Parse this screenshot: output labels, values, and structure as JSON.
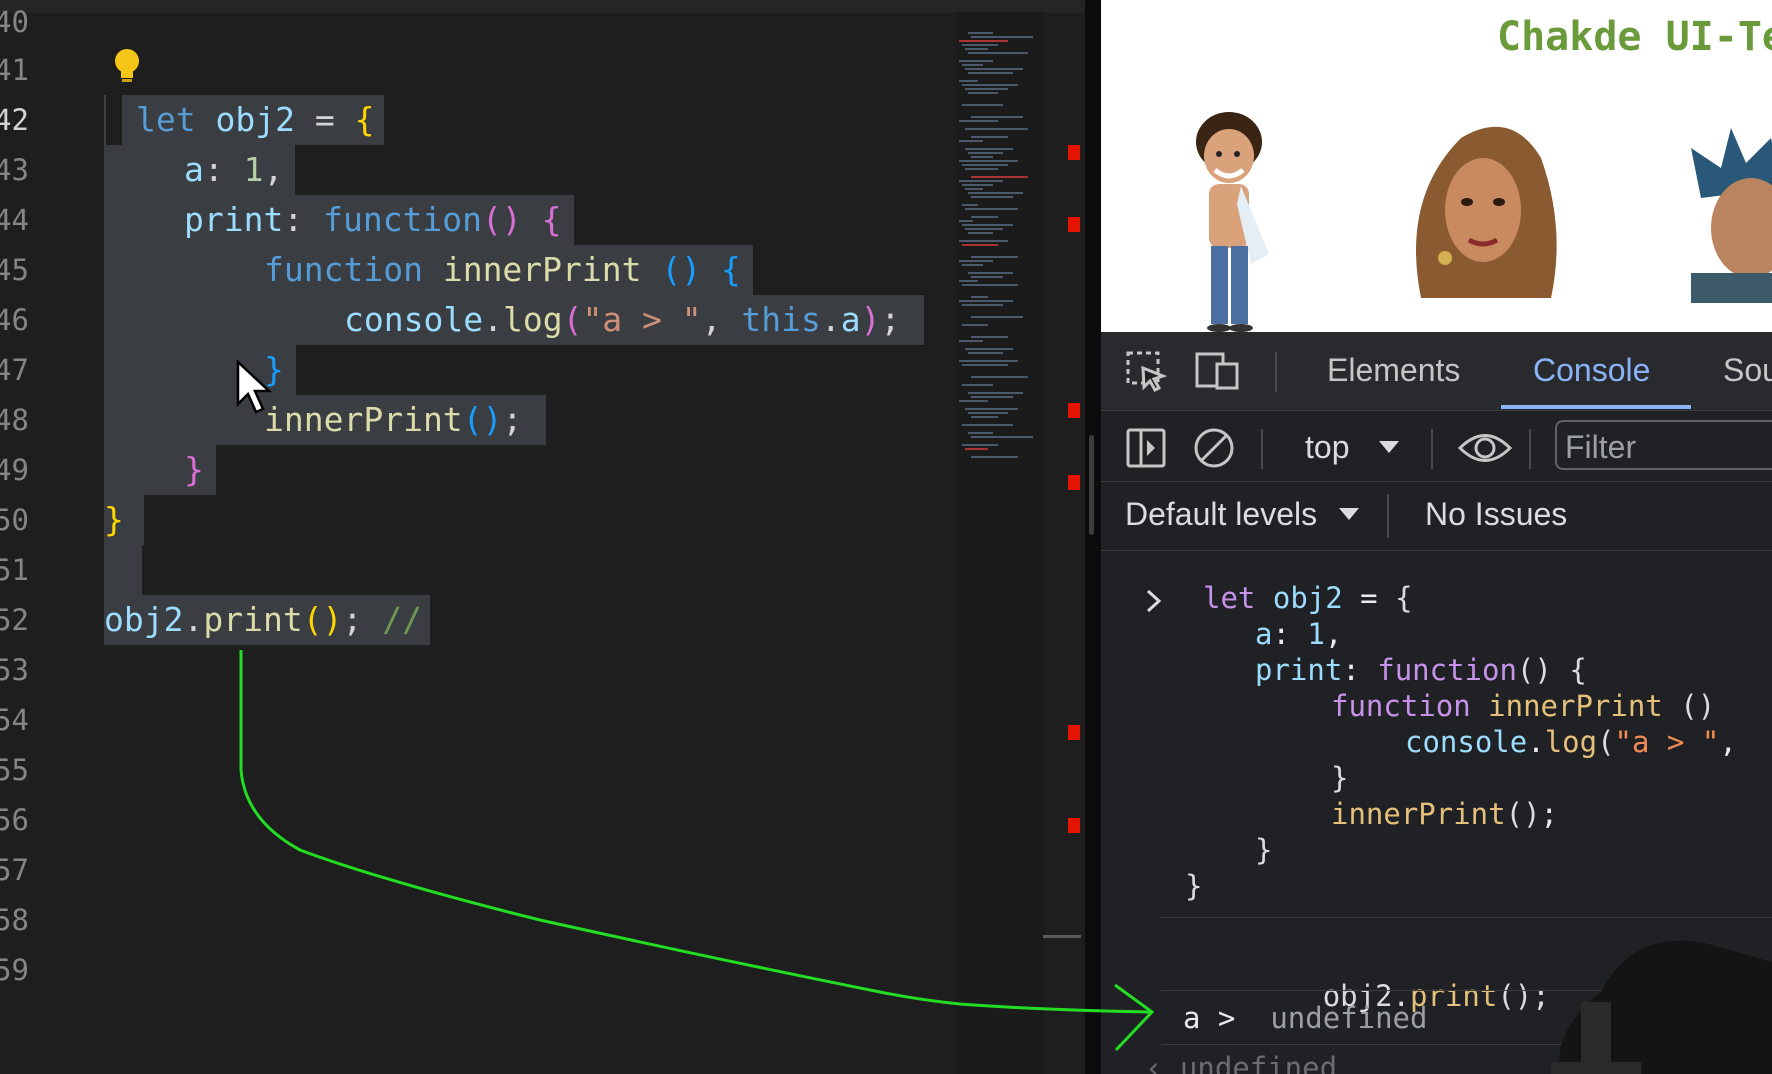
{
  "editor": {
    "line_numbers": [
      "40",
      "41",
      "42",
      "43",
      "44",
      "45",
      "46",
      "47",
      "48",
      "49",
      "50",
      "51",
      "52",
      "53",
      "54",
      "55",
      "56",
      "57",
      "58",
      "59"
    ],
    "active_line": "42",
    "code_lines": [
      {
        "n": "42",
        "text": "let obj2 = {"
      },
      {
        "n": "43",
        "text": "a: 1,"
      },
      {
        "n": "44",
        "text": "print: function() {"
      },
      {
        "n": "45",
        "text": "function innerPrint () {"
      },
      {
        "n": "46",
        "text": "console.log(\"a > \", this.a);"
      },
      {
        "n": "47",
        "text": "}"
      },
      {
        "n": "48",
        "text": "innerPrint();"
      },
      {
        "n": "49",
        "text": "}"
      },
      {
        "n": "50",
        "text": "}"
      },
      {
        "n": "52",
        "text": "obj2.print(); //"
      }
    ]
  },
  "page": {
    "title": "Chakde UI-Te"
  },
  "devtools": {
    "tabs": [
      "Elements",
      "Console",
      "Sou"
    ],
    "active_tab": "Console",
    "context": "top",
    "filter_placeholder": "Filter",
    "levels": "Default levels",
    "issues": "No Issues",
    "console_lines": [
      "let obj2 = {",
      "a: 1,",
      "print: function() {",
      "function innerPrint ()",
      "console.log(\"a > \",",
      "}",
      "innerPrint();",
      "}",
      "}"
    ],
    "command": "obj2.print();",
    "output_label": "a >",
    "output_value": "undefined",
    "return_value": "undefined"
  },
  "colors": {
    "editor_bg": "#1e1e1e",
    "selection": "#3a3d41",
    "keyword": "#569cd6",
    "devtools_bg": "#202124",
    "accent": "#8ab4f8",
    "annotation_arrow": "#22dd22"
  }
}
